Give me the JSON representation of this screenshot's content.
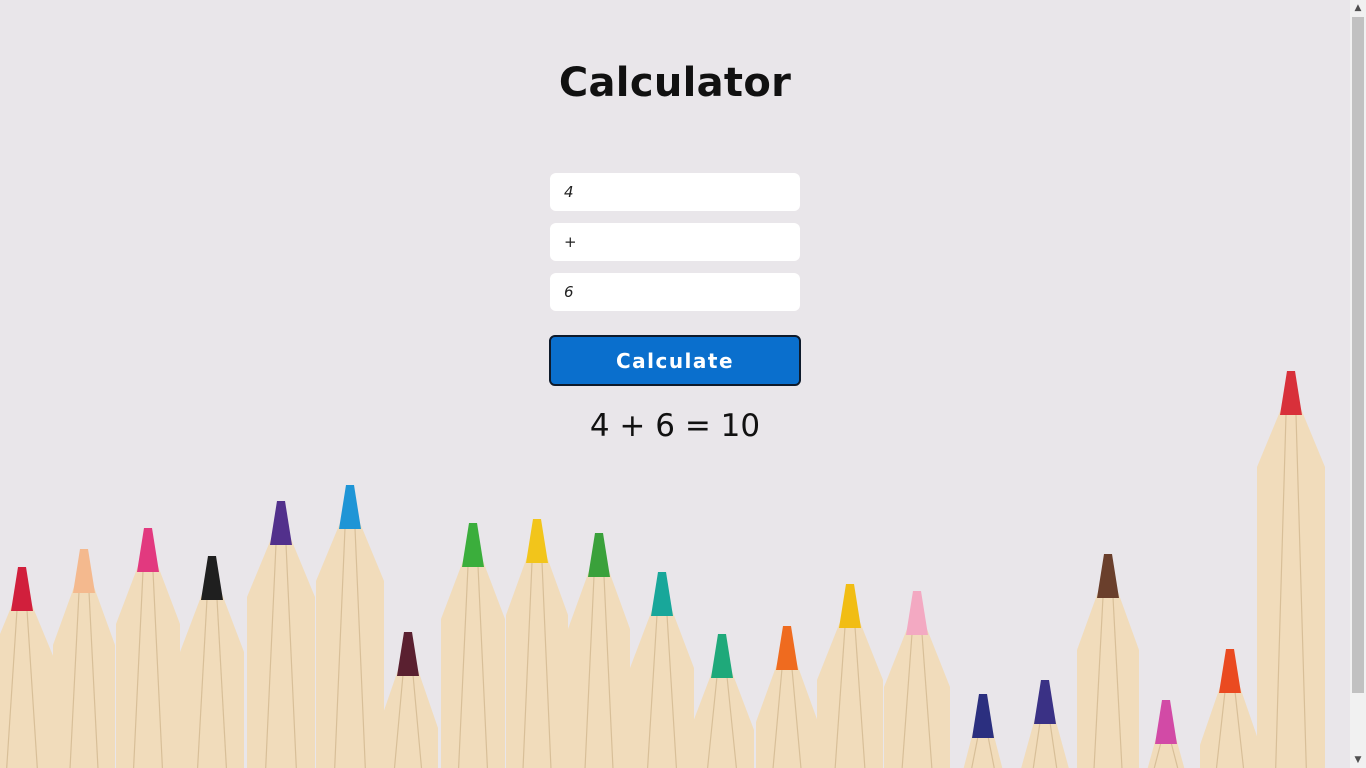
{
  "page": {
    "title": "Calculator"
  },
  "form": {
    "first_number": "4",
    "operator": "+",
    "second_number": "6"
  },
  "button": {
    "calculate_label": "Calculate"
  },
  "result": {
    "text": "4 + 6 = 10"
  },
  "scrollbar": {
    "up_icon": "▲",
    "down_icon": "▼"
  },
  "colors": {
    "background": "#e9e6ea",
    "button": "#0a6fcd",
    "pencil_wood": "#f1dcbb"
  },
  "background_image": "colored-pencils-row",
  "pencils": [
    {
      "tip": "#d11f3c",
      "tipTop": 567,
      "half": 34
    },
    {
      "tip": "#f4b98e",
      "tipTop": 549,
      "half": 31
    },
    {
      "tip": "#e2397f",
      "tipTop": 528,
      "half": 32
    },
    {
      "tip": "#1f1f1f",
      "tipTop": 556,
      "half": 32
    },
    {
      "tip": "#52308c",
      "tipTop": 501,
      "half": 34
    },
    {
      "tip": "#1f95d6",
      "tipTop": 485,
      "half": 34
    },
    {
      "tip": "#5a2030",
      "tipTop": 632,
      "half": 30
    },
    {
      "tip": "#3bae3c",
      "tipTop": 523,
      "half": 32
    },
    {
      "tip": "#f2c51b",
      "tipTop": 519,
      "half": 31
    },
    {
      "tip": "#3aa13b",
      "tipTop": 533,
      "half": 31
    },
    {
      "tip": "#18a79a",
      "tipTop": 572,
      "half": 32
    },
    {
      "tip": "#1fa97a",
      "tipTop": 634,
      "half": 32
    },
    {
      "tip": "#ef6b1f",
      "tipTop": 626,
      "half": 31
    },
    {
      "tip": "#f1bd14",
      "tipTop": 584,
      "half": 33
    },
    {
      "tip": "#f3a9c2",
      "tipTop": 591,
      "half": 33
    },
    {
      "tip": "#2b2f7f",
      "tipTop": 694,
      "half": 25
    },
    {
      "tip": "#3a3185",
      "tipTop": 680,
      "half": 26
    },
    {
      "tip": "#6a3f2c",
      "tipTop": 554,
      "half": 31
    },
    {
      "tip": "#d24aa6",
      "tipTop": 700,
      "half": 26
    },
    {
      "tip": "#ea4a21",
      "tipTop": 649,
      "half": 30
    },
    {
      "tip": "#d8303a",
      "tipTop": 371,
      "half": 34
    }
  ]
}
